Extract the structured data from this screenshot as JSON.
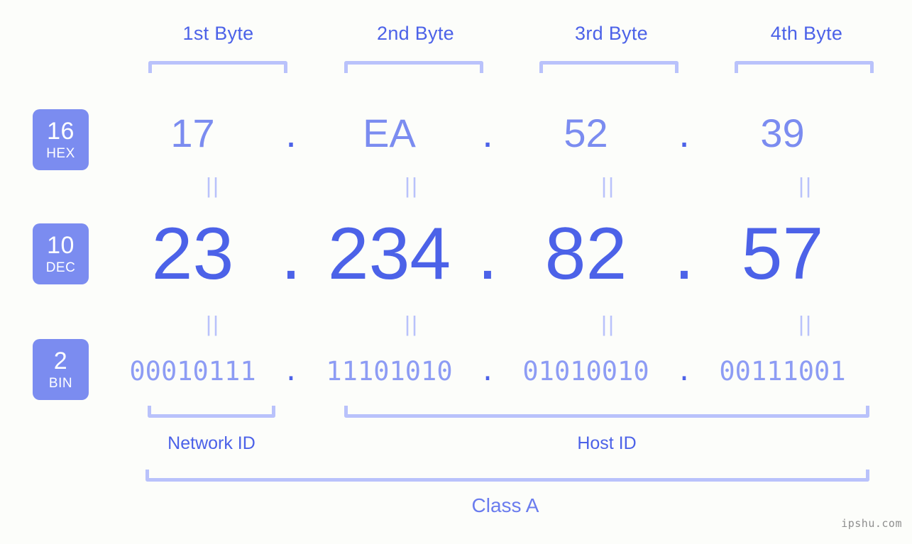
{
  "meta": {
    "watermark": "ipshu.com",
    "background_color": "#fcfdfa",
    "accent_strong": "#4c62e8",
    "accent_mid": "#7b8cf0",
    "accent_light": "#b9c2fb"
  },
  "headers": {
    "bytes": [
      {
        "label": "1st Byte"
      },
      {
        "label": "2nd Byte"
      },
      {
        "label": "3rd Byte"
      },
      {
        "label": "4th Byte"
      }
    ]
  },
  "bases": [
    {
      "number": "16",
      "abbr": "HEX"
    },
    {
      "number": "10",
      "abbr": "DEC"
    },
    {
      "number": "2",
      "abbr": "BIN"
    }
  ],
  "rows": {
    "hex": {
      "values": [
        "17",
        "EA",
        "52",
        "39"
      ],
      "separator": "."
    },
    "dec": {
      "values": [
        "23",
        "234",
        "82",
        "57"
      ],
      "separator": "."
    },
    "bin": {
      "values": [
        "00010111",
        "11101010",
        "01010010",
        "00111001"
      ],
      "separator": "."
    }
  },
  "equals": {
    "symbol": "||",
    "count_per_row": 4
  },
  "sections": [
    {
      "label": "Network ID"
    },
    {
      "label": "Host ID"
    }
  ],
  "class": {
    "label": "Class A"
  }
}
